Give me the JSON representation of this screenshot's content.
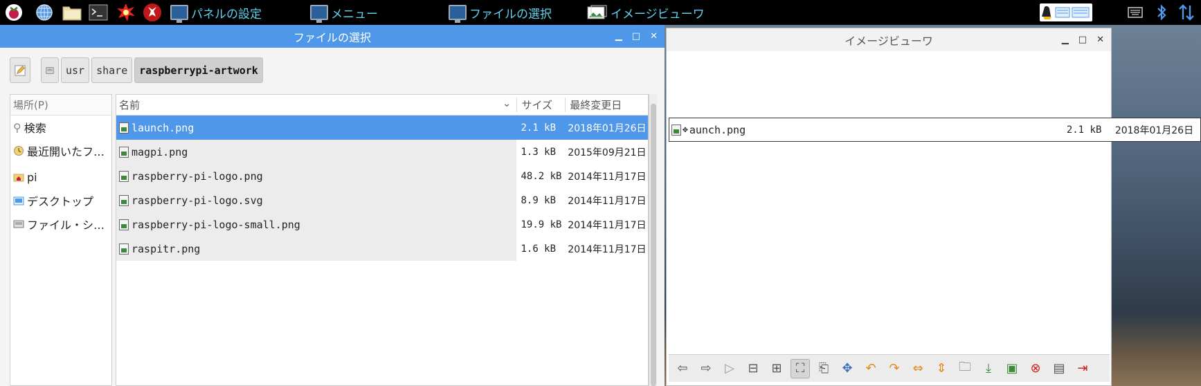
{
  "taskbar": {
    "tasks": [
      {
        "label": "パネルの設定"
      },
      {
        "label": "メニュー"
      },
      {
        "label": "ファイルの選択"
      },
      {
        "label": "イメージビューワ"
      }
    ]
  },
  "file_chooser": {
    "title": "ファイルの選択",
    "path": [
      "usr",
      "share",
      "raspberrypi-artwork"
    ],
    "places_header": "場所(P)",
    "places": [
      {
        "label": "検索"
      },
      {
        "label": "最近開いたフ…"
      },
      {
        "label": "pi"
      },
      {
        "label": "デスクトップ"
      },
      {
        "label": "ファイル・シ…"
      }
    ],
    "columns": {
      "name": "名前",
      "size": "サイズ",
      "modified": "最終変更日"
    },
    "files": [
      {
        "name": "launch.png",
        "size": "2.1 kB",
        "modified": "2018年01月26日",
        "selected": true
      },
      {
        "name": "magpi.png",
        "size": "1.3 kB",
        "modified": "2015年09月21日"
      },
      {
        "name": "raspberry-pi-logo.png",
        "size": "48.2 kB",
        "modified": "2014年11月17日"
      },
      {
        "name": "raspberry-pi-logo.svg",
        "size": "8.9 kB",
        "modified": "2014年11月17日"
      },
      {
        "name": "raspberry-pi-logo-small.png",
        "size": "19.9 kB",
        "modified": "2014年11月17日"
      },
      {
        "name": "raspitr.png",
        "size": "1.6 kB",
        "modified": "2014年11月17日"
      }
    ]
  },
  "image_viewer": {
    "title": "イメージビューワ",
    "drag_item": {
      "name": "aunch.png",
      "size": "2.1 kB",
      "modified": "2018年01月26日"
    }
  }
}
